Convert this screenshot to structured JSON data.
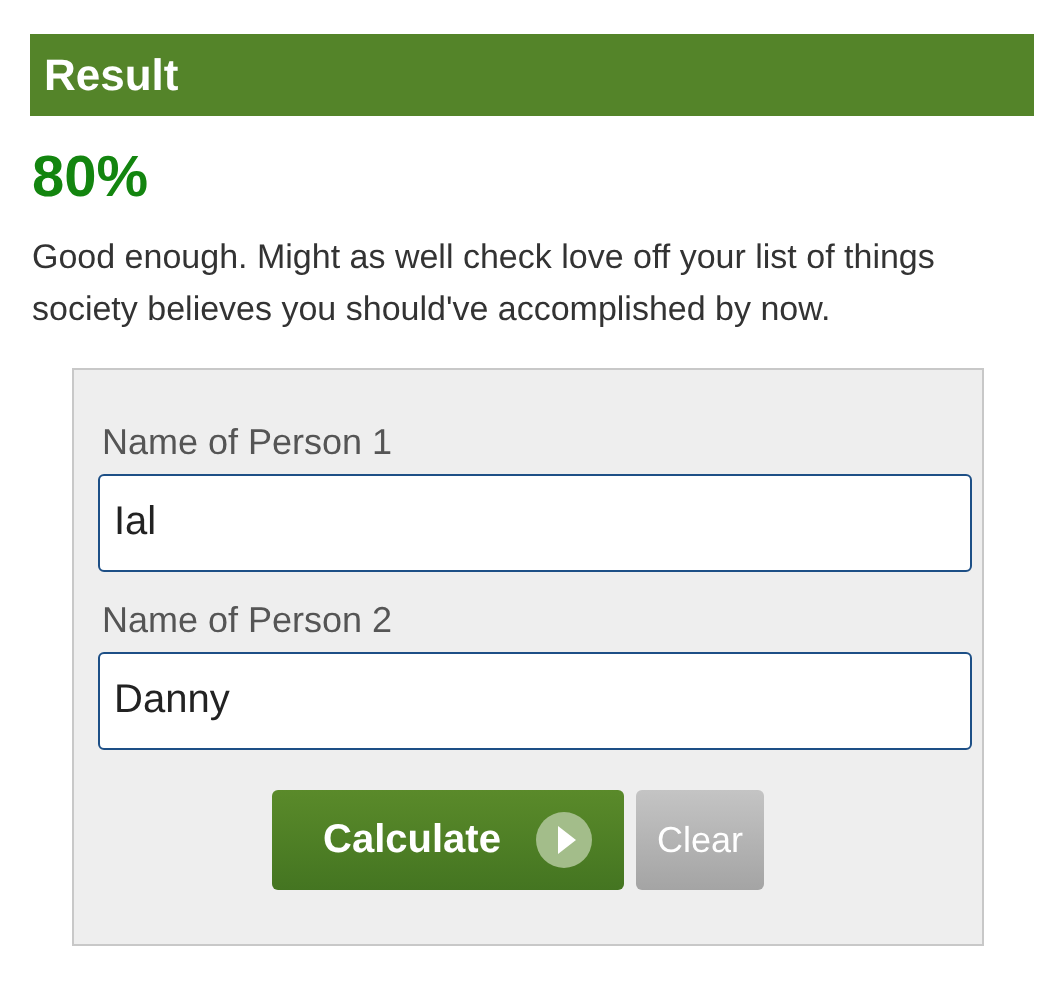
{
  "result": {
    "title": "Result",
    "score": "80%",
    "message": "Good enough. Might as well check love off your list of things society believes you should've accomplished by now."
  },
  "form": {
    "fields": [
      {
        "label": "Name of Person 1",
        "value": "Ial"
      },
      {
        "label": "Name of Person 2",
        "value": "Danny"
      }
    ],
    "buttons": [
      {
        "kind": "primary",
        "label": "Calculate"
      },
      {
        "kind": "secondary",
        "label": "Clear"
      }
    ]
  }
}
